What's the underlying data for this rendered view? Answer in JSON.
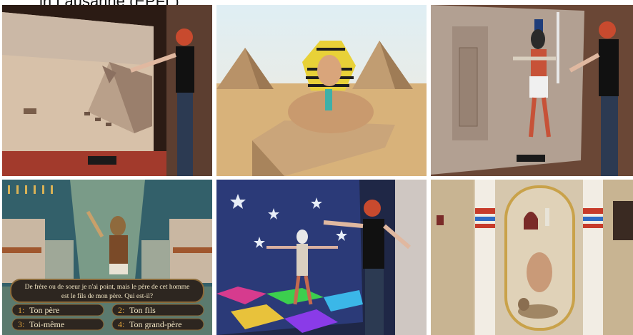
{
  "caption": "in Lausanne (EPFL)",
  "tiles": [
    {
      "label": "desert-pyramid-vr-wall"
    },
    {
      "label": "sphinx-pharaoh-3d"
    },
    {
      "label": "anubis-wall-interaction"
    },
    {
      "label": "quiz-game-horus"
    },
    {
      "label": "dancing-figure-interaction"
    },
    {
      "label": "cartouche-hieroglyphs"
    }
  ],
  "quiz": {
    "question_line1": "De frère ou de soeur je n'ai point, mais le père de cet homme",
    "question_line2": "est le fils de mon père. Qui est-il?",
    "answers": [
      {
        "num": "1:",
        "text": "Ton père"
      },
      {
        "num": "2:",
        "text": "Ton fils"
      },
      {
        "num": "3:",
        "text": "Toi-même"
      },
      {
        "num": "4:",
        "text": "Ton grand-père"
      }
    ]
  }
}
